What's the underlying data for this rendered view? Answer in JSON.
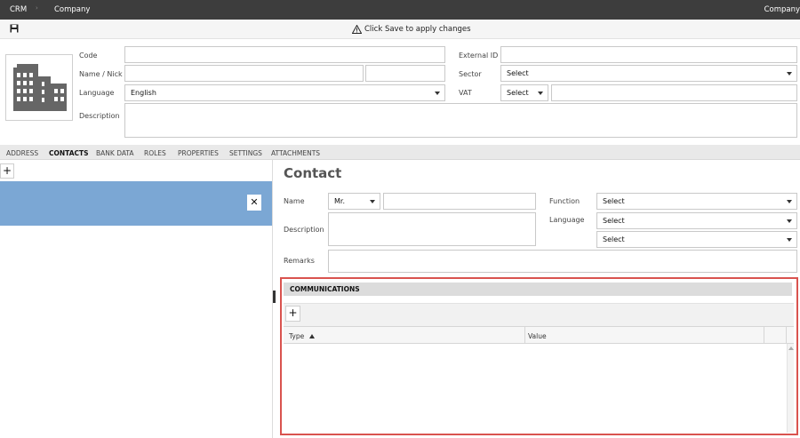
{
  "topbar": {
    "app": "CRM",
    "module": "Company",
    "right": "Company"
  },
  "savebar": {
    "message": "Click Save to apply changes"
  },
  "header": {
    "code_label": "Code",
    "name_label": "Name / Nick",
    "language_label": "Language",
    "language_value": "English",
    "description_label": "Description",
    "external_id_label": "External ID",
    "sector_label": "Sector",
    "sector_value": "Select",
    "vat_label": "VAT",
    "vat_value": "Select"
  },
  "tabs": [
    "ADDRESS",
    "CONTACTS",
    "BANK DATA",
    "ROLES",
    "PROPERTIES",
    "SETTINGS",
    "ATTACHMENTS"
  ],
  "contact": {
    "title": "Contact",
    "name_label": "Name",
    "title_value": "Mr.",
    "description_label": "Description",
    "remarks_label": "Remarks",
    "function_label": "Function",
    "function_value": "Select",
    "language_label": "Language",
    "language_value_1": "Select",
    "language_value_2": "Select"
  },
  "communications": {
    "title": "COMMUNICATIONS",
    "col_type": "Type",
    "col_value": "Value"
  },
  "icons": {
    "save": "save-icon",
    "warning": "warning-icon",
    "building": "building-icon",
    "add": "plus-icon",
    "close": "close-icon",
    "sort": "sort-up-icon"
  },
  "colors": {
    "topbar": "#3d3d3d",
    "selection": "#7ba7d4",
    "highlight": "#d9534f"
  }
}
